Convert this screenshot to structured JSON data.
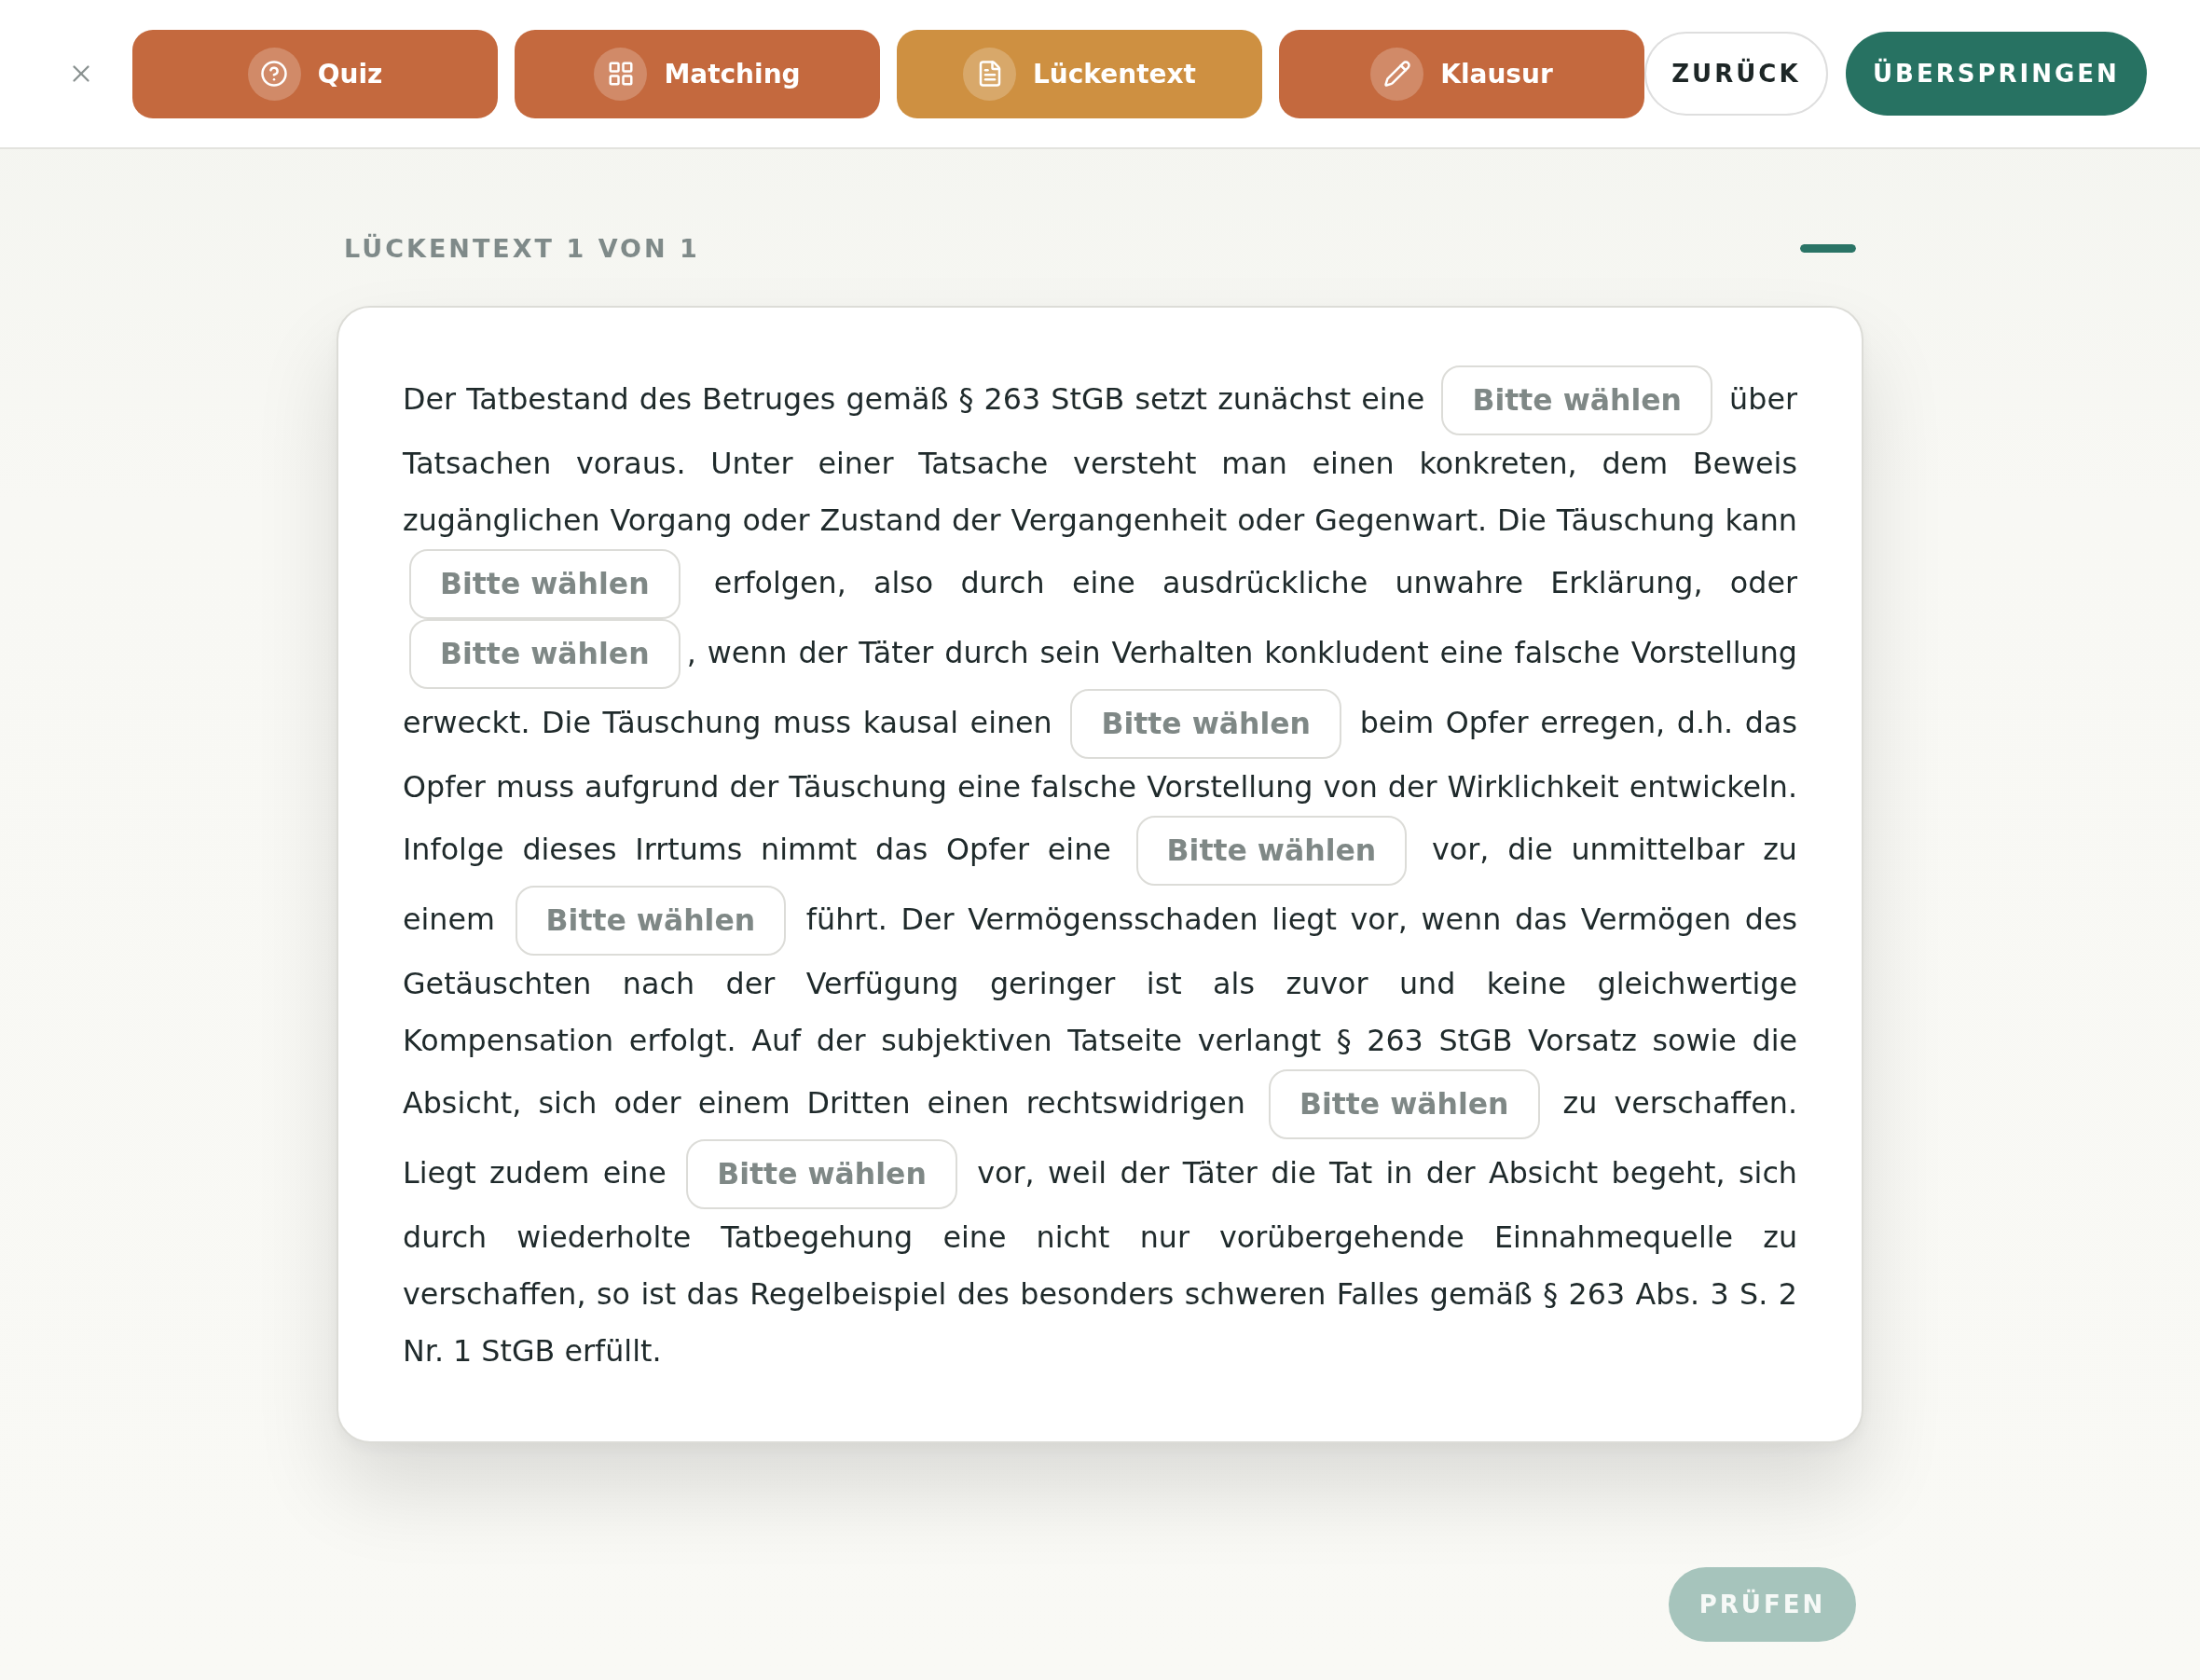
{
  "tabs": [
    {
      "label": "Quiz",
      "selected": false
    },
    {
      "label": "Matching",
      "selected": false
    },
    {
      "label": "Lückentext",
      "selected": true
    },
    {
      "label": "Klausur",
      "selected": false
    }
  ],
  "nav_buttons": {
    "back": "ZURÜCK",
    "skip": "ÜBERSPRINGEN"
  },
  "exercise": {
    "heading": "LÜCKENTEXT 1 VON 1",
    "progress": {
      "level": 1
    },
    "passage": [
      {
        "kind": "text",
        "text": "Der Tatbestand des Betruges gemäß § 263 StGB setzt zunächst eine "
      },
      {
        "kind": "gap",
        "placeholder": "Bitte wählen"
      },
      {
        "kind": "text",
        "text": " über Tatsachen voraus. Unter einer Tatsache versteht man einen konkreten, dem Beweis zugänglichen Vorgang oder Zustand der Vergangenheit oder Gegenwart. Die Täuschung kann "
      },
      {
        "kind": "gap",
        "placeholder": "Bitte wählen"
      },
      {
        "kind": "text",
        "text": " erfolgen, also durch eine ausdrückliche unwahre Erklärung, oder "
      },
      {
        "kind": "gap",
        "placeholder": "Bitte wählen"
      },
      {
        "kind": "text",
        "text": ", wenn der Täter durch sein Verhalten konkludent eine falsche Vorstellung erweckt. Die Täuschung muss kausal einen "
      },
      {
        "kind": "gap",
        "placeholder": "Bitte wählen"
      },
      {
        "kind": "text",
        "text": " beim Opfer erregen, d.h. das Opfer muss aufgrund der Täuschung eine falsche Vorstellung von der Wirklichkeit entwickeln. Infolge dieses Irrtums nimmt das Opfer eine "
      },
      {
        "kind": "gap",
        "placeholder": "Bitte wählen"
      },
      {
        "kind": "text",
        "text": " vor, die unmittelbar zu einem "
      },
      {
        "kind": "gap",
        "placeholder": "Bitte wählen"
      },
      {
        "kind": "text",
        "text": " führt. Der Vermögensschaden liegt vor, wenn das Vermögen des Getäuschten nach der Verfügung geringer ist als zuvor und keine gleichwertige Kompensation erfolgt. Auf der subjektiven Tatseite verlangt § 263 StGB Vorsatz sowie die Absicht, sich oder einem Dritten einen rechtswidrigen "
      },
      {
        "kind": "gap",
        "placeholder": "Bitte wählen"
      },
      {
        "kind": "text",
        "text": " zu verschaffen. Liegt zudem eine "
      },
      {
        "kind": "gap",
        "placeholder": "Bitte wählen"
      },
      {
        "kind": "text",
        "text": " vor, weil der Täter die Tat in der Absicht begeht, sich durch wiederholte Tatbegehung eine nicht nur vorübergehende Einnahmequelle zu verschaffen, so ist das Regelbeispiel des besonders schweren Falles gemäß § 263 Abs. 3 S. 2 Nr. 1 StGB erfüllt."
      }
    ]
  },
  "check_button": {
    "label": "PRÜFEN",
    "disabled": true
  }
}
